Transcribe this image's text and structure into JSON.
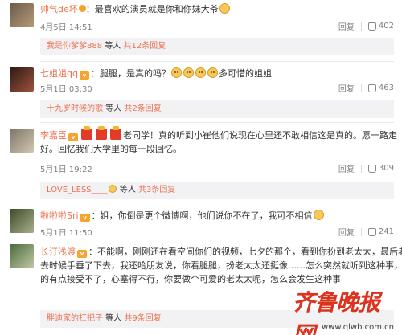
{
  "comments": [
    {
      "user": "帅气de坏",
      "text_before": "：最喜欢的演员就是你和你妹大爷",
      "time": "4月5日 14:51",
      "reply_label": "回复",
      "likes": "402",
      "replies": {
        "user": "我是你爹爹888",
        "middle": " 等人 ",
        "count": "共12条回复"
      }
    },
    {
      "user": "七姐姐qq",
      "text_before": "：腿腿，是真的吗？",
      "text_after": "多可惜的姐姐",
      "time": "5月1日 03:30",
      "reply_label": "回复",
      "likes": "463",
      "replies": {
        "user": "十九岁时候的歌",
        "middle": " 等人 ",
        "count": "共2条回复"
      }
    },
    {
      "user": "李嘉臣",
      "text_after": "老同学！真的听到小崔他们说现在心里还不敢相信这是真的。愿一路走",
      "text_line2": "好。回忆我们大学里的每一段回忆。",
      "time": "5月1日 19:22",
      "reply_label": "回复",
      "likes": "309",
      "replies": {
        "user": "LOVE_LESS____",
        "middle": " 等人 ",
        "count": "共3条回复"
      }
    },
    {
      "user": "啦啦啦Sri",
      "text_before": "：姐，你倒是更个微博啊，他们说你不在了，我可不相信",
      "time": "5月1日 11:50",
      "reply_label": "回复",
      "likes": "241"
    },
    {
      "user": "长汀浅渡",
      "text_before": "：不能啊，刚刚还在看空间你们的视频，七夕的那个，看到你扮到老太太，最后老",
      "text_line2": "去时候手垂了下去，我还哈朋友说，你看腿腿，扮老太太还挺像……怎么突然就听到这种事，我真",
      "text_line3": "的有点接受不了，心塞得不行，你要做个可爱的老太太呢，怎么会发生这种事",
      "replies": {
        "user": "胖迪家的扛把子",
        "middle": " 等人 ",
        "count": "共9条回复"
      }
    }
  ],
  "watermark": {
    "text": "齐鲁晚报网",
    "url": "www.qlwb.com.cn"
  },
  "colors": {
    "username": "#eb7350",
    "meta": "#808080",
    "reply_bg": "#f2f2f5",
    "watermark": "#d81e06"
  }
}
